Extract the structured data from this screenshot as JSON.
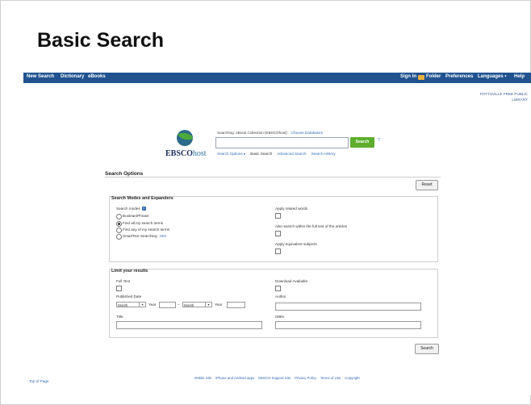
{
  "slide": {
    "title": "Basic Search"
  },
  "topbar": {
    "left": [
      "New Search",
      "Dictionary",
      "eBooks"
    ],
    "sign_in": "Sign In",
    "folder": "Folder",
    "preferences": "Preferences",
    "languages": "Languages •",
    "help": "Help"
  },
  "library": "POTTSVILLE FREE PUBLIC LIBRARY",
  "logo": {
    "brand": "EBSCO",
    "host": "host"
  },
  "search": {
    "searching": "Searching: eBook Collection (EBSCOhost)",
    "choose_db": "Choose Databases",
    "input_value": "",
    "button": "Search",
    "help": "?"
  },
  "sublinks": {
    "options": "Search Options ▸",
    "basic": "Basic Search",
    "advanced": "Advanced Search",
    "history": "Search History"
  },
  "options": {
    "title": "Search Options",
    "reset": "Reset",
    "modes": {
      "title": "Search Modes and Expanders",
      "label": "Search modes",
      "help": "?",
      "items": [
        "Boolean/Phrase",
        "Find all my search terms",
        "Find any of my search terms",
        "SmartText Searching"
      ],
      "hint": "Hint",
      "selected_index": 1,
      "right": [
        "Apply related words",
        "Also search within the full text of the articles",
        "Apply equivalent subjects"
      ]
    },
    "limit": {
      "title": "Limit your results",
      "full_text": "Full Text",
      "download": "Download Available",
      "published": "Published Date",
      "month1": "Month",
      "year1": "Year",
      "dash": "–",
      "month2": "Month",
      "year2": "Year",
      "author": "Author",
      "title_label": "Title",
      "isbn": "ISBN"
    },
    "search_button": "Search"
  },
  "footer": {
    "top": "Top of Page",
    "links": [
      "Mobile Site",
      "iPhone and Android apps",
      "EBSCO Support Site",
      "Privacy Policy",
      "Terms of Use",
      "Copyright"
    ]
  },
  "colors": {
    "topbar": "#20528f",
    "search_button": "#5cae2c",
    "link": "#2f6db3"
  }
}
